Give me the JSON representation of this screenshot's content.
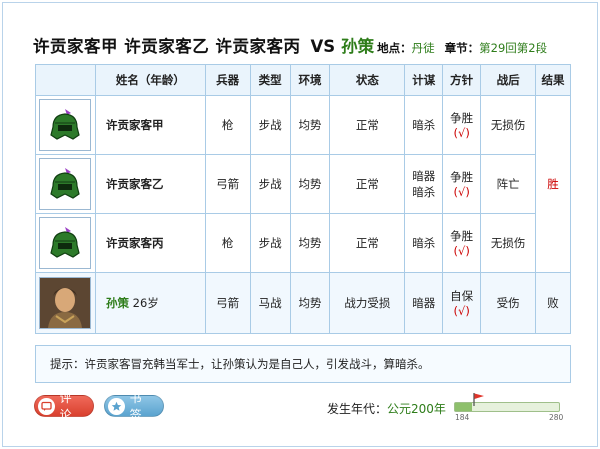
{
  "header": {
    "attackers": "许贡家客甲  许贡家客乙  许贡家客丙",
    "vs": "VS",
    "defender": "孙策",
    "location_label": "地点：",
    "location_value": "丹徒",
    "chapter_label": "章节：",
    "chapter_value": "第29回第2段"
  },
  "table": {
    "headers": [
      "姓名（年龄）",
      "兵器",
      "类型",
      "环境",
      "状态",
      "计谋",
      "方针",
      "战后",
      "结果"
    ],
    "rows": [
      {
        "name": "许贡家客甲",
        "weapon": "枪",
        "type": "步战",
        "terrain": "均势",
        "status": "正常",
        "tactic": "暗杀",
        "policy": "争胜",
        "check": "(√)",
        "after": "无损伤"
      },
      {
        "name": "许贡家客乙",
        "weapon": "弓箭",
        "type": "步战",
        "terrain": "均势",
        "status": "正常",
        "tactic": "暗器",
        "tactic2": "暗杀",
        "policy": "争胜",
        "check": "(√)",
        "after": "阵亡"
      },
      {
        "name": "许贡家客丙",
        "weapon": "枪",
        "type": "步战",
        "terrain": "均势",
        "status": "正常",
        "tactic": "暗杀",
        "policy": "争胜",
        "check": "(√)",
        "after": "无损伤"
      }
    ],
    "group_result": "胜",
    "player": {
      "name": "孙策",
      "age": "26岁",
      "weapon": "弓箭",
      "type": "马战",
      "terrain": "均势",
      "status": "战力受损",
      "tactic": "暗器",
      "policy": "自保",
      "check": "(√)",
      "after": "受伤",
      "result": "败"
    }
  },
  "tip": {
    "label": "提示：",
    "text": "许贡家客冒充韩当军士，让孙策认为是自己人，引发战斗，算暗杀。"
  },
  "buttons": {
    "comment": "评论",
    "bookmark": "书签"
  },
  "era": {
    "label": "发生年代：",
    "value": "公元200年",
    "range_min": "184",
    "range_max": "280",
    "progress": 0.167
  },
  "colors": {
    "green": "#2e7d1a",
    "red": "#cc0000",
    "border": "#a9cbe6",
    "header_bg": "#eaf4fc"
  },
  "icons": {
    "attacker_portrait": "green-helmet-icon",
    "player_portrait": "warrior-portrait",
    "comment": "comment-icon",
    "bookmark": "bookmark-icon",
    "slider_marker": "flag-icon"
  }
}
